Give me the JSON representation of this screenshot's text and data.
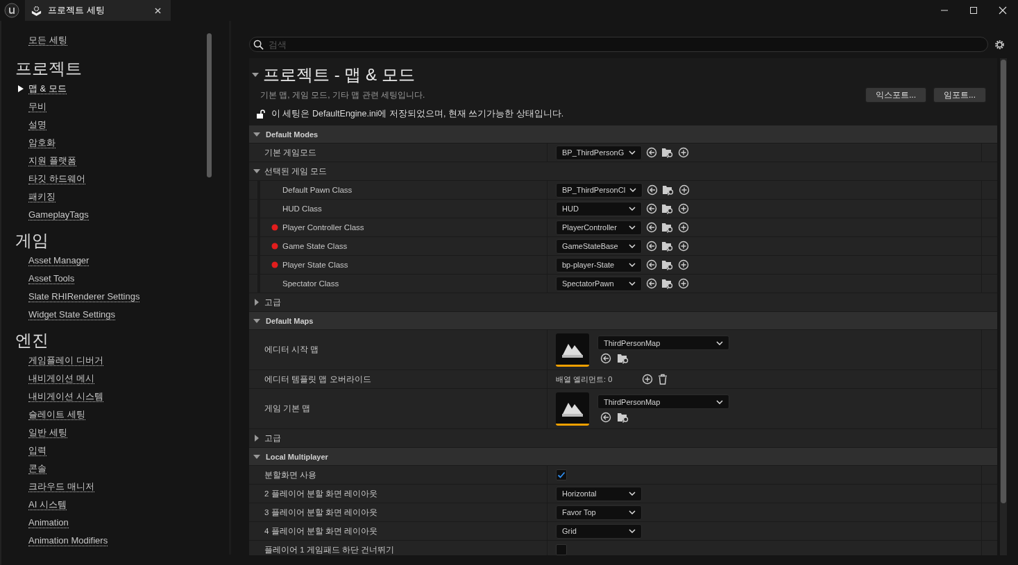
{
  "tab": {
    "title": "프로젝트 세팅"
  },
  "sidebar": {
    "all_settings": "모든 세팅",
    "categories": [
      {
        "title": "프로젝트",
        "items": [
          {
            "label": "맵 & 모드",
            "selected": true
          },
          {
            "label": "무비",
            "selected": false
          },
          {
            "label": "설명",
            "selected": false
          },
          {
            "label": "암호화",
            "selected": false
          },
          {
            "label": "지원 플랫폼",
            "selected": false
          },
          {
            "label": "타깃 하드웨어",
            "selected": false
          },
          {
            "label": "패키징",
            "selected": false
          },
          {
            "label": "GameplayTags",
            "selected": false
          }
        ]
      },
      {
        "title": "게임",
        "items": [
          {
            "label": "Asset Manager",
            "selected": false
          },
          {
            "label": "Asset Tools",
            "selected": false
          },
          {
            "label": "Slate RHIRenderer Settings",
            "selected": false
          },
          {
            "label": "Widget State Settings",
            "selected": false
          }
        ]
      },
      {
        "title": "엔진",
        "items": [
          {
            "label": "게임플레이 디버거",
            "selected": false
          },
          {
            "label": "내비게이션 메시",
            "selected": false
          },
          {
            "label": "내비게이션 시스템",
            "selected": false
          },
          {
            "label": "슬레이트 세팅",
            "selected": false
          },
          {
            "label": "일반 세팅",
            "selected": false
          },
          {
            "label": "입력",
            "selected": false
          },
          {
            "label": "콘솔",
            "selected": false
          },
          {
            "label": "크라우드 매니저",
            "selected": false
          },
          {
            "label": "AI 시스템",
            "selected": false
          },
          {
            "label": "Animation",
            "selected": false
          },
          {
            "label": "Animation Modifiers",
            "selected": false
          }
        ]
      }
    ]
  },
  "search": {
    "placeholder": "검색"
  },
  "header": {
    "title": "프로젝트 - 맵 & 모드",
    "expanded": true,
    "description": "기본 맵, 게임 모드, 기타 맵 관련 세팅입니다.",
    "notice": "이 세팅은 DefaultEngine.ini에 저장되었으며, 현재 쓰기가능한 상태입니다.",
    "buttons": [
      "익스포트...",
      "임포트..."
    ]
  },
  "sections": [
    {
      "title": "Default Modes",
      "expanded": true,
      "rows": [
        {
          "kind": "combo",
          "label": "기본 게임모드",
          "value": "BP_ThirdPersonG"
        },
        {
          "kind": "group",
          "label": "선택된 게임 모드",
          "expanded": true,
          "children": [
            {
              "kind": "combo",
              "label": "Default Pawn Class",
              "value": "BP_ThirdPersonCl",
              "flagged": false
            },
            {
              "kind": "combo",
              "label": "HUD Class",
              "value": "HUD",
              "flagged": false
            },
            {
              "kind": "combo",
              "label": "Player Controller Class",
              "value": "PlayerController",
              "flagged": true
            },
            {
              "kind": "combo",
              "label": "Game State Class",
              "value": "GameStateBase",
              "flagged": true
            },
            {
              "kind": "combo",
              "label": "Player State Class",
              "value": "bp-player-State",
              "flagged": true
            },
            {
              "kind": "combo",
              "label": "Spectator Class",
              "value": "SpectatorPawn",
              "flagged": false
            }
          ]
        },
        {
          "kind": "advanced",
          "label": "고급",
          "expanded": false
        }
      ]
    },
    {
      "title": "Default Maps",
      "expanded": true,
      "rows": [
        {
          "kind": "map",
          "label": "에디터 시작 맵",
          "value": "ThirdPersonMap"
        },
        {
          "kind": "array",
          "label": "에디터 템플릿 맵 오버라이드",
          "value": "배열 엘리먼트: 0"
        },
        {
          "kind": "map",
          "label": "게임 기본 맵",
          "value": "ThirdPersonMap"
        },
        {
          "kind": "advanced",
          "label": "고급",
          "expanded": false
        }
      ]
    },
    {
      "title": "Local Multiplayer",
      "expanded": true,
      "rows": [
        {
          "kind": "check",
          "label": "분할화면 사용",
          "checked": true
        },
        {
          "kind": "enum",
          "label": "2 플레이어 분할 화면 레이아웃",
          "value": "Horizontal"
        },
        {
          "kind": "enum",
          "label": "3 플레이어 분할 화면 레이아웃",
          "value": "Favor Top"
        },
        {
          "kind": "enum",
          "label": "4 플레이어 분할 화면 레이아웃",
          "value": "Grid"
        },
        {
          "kind": "check",
          "label": "플레이어 1 게임패드 하단 건너뛰기",
          "checked": false
        }
      ]
    }
  ]
}
